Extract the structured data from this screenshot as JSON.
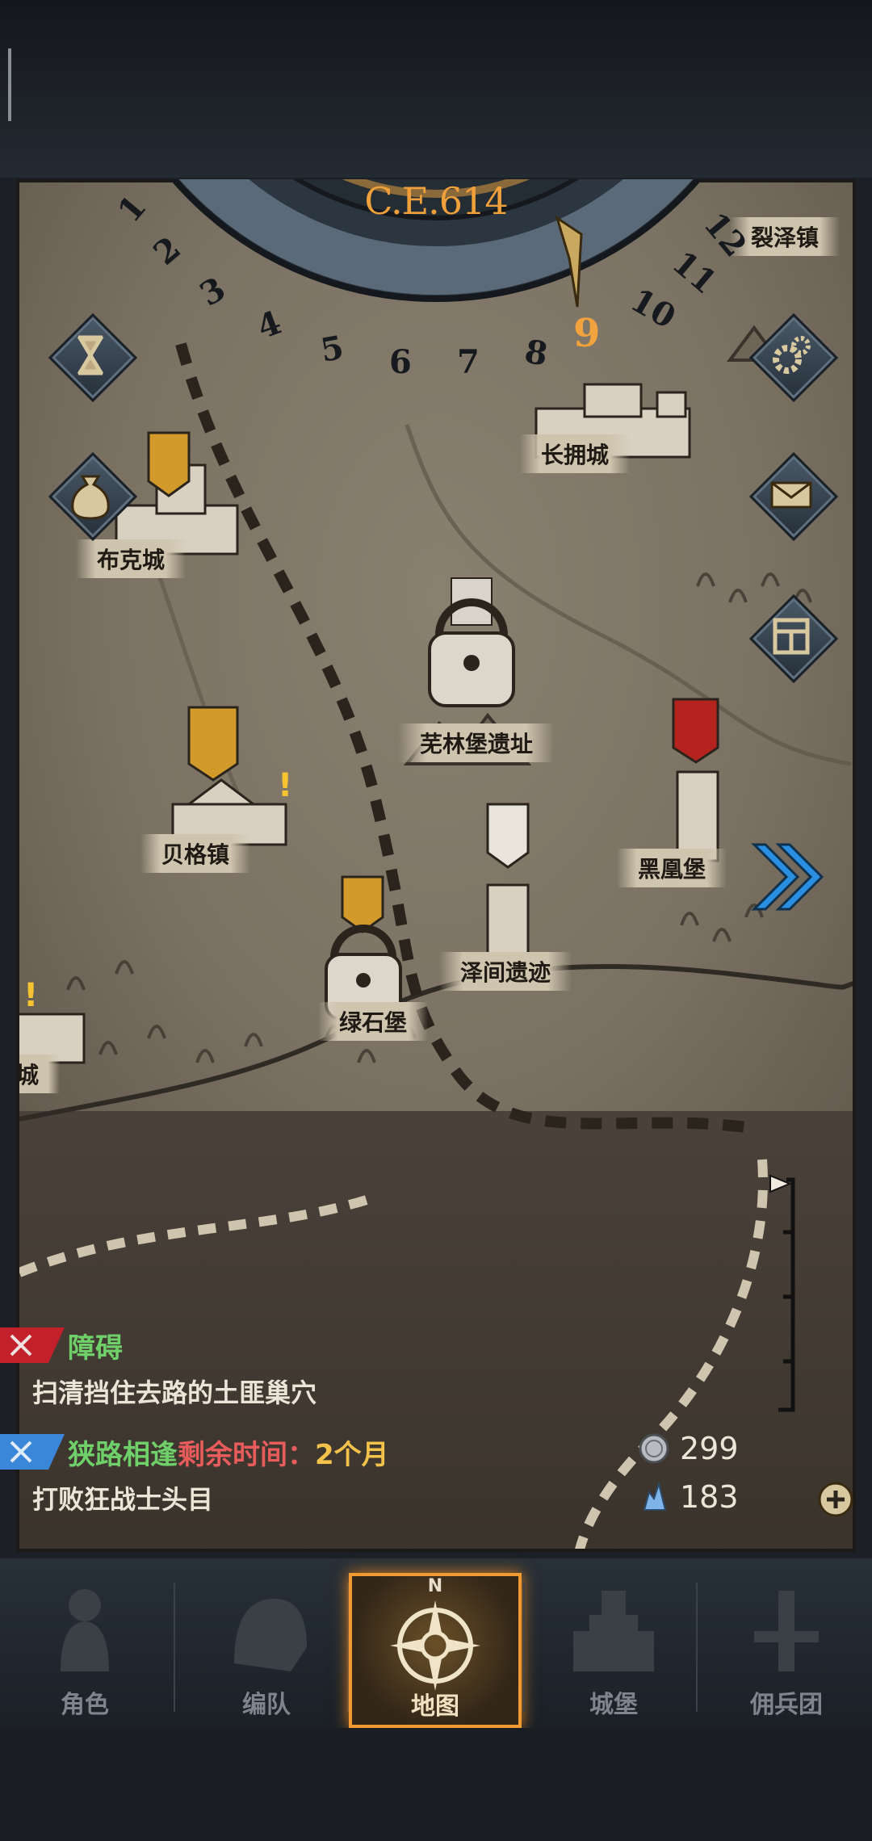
{
  "calendar": {
    "year_label": "C.E.614",
    "months": [
      "1",
      "2",
      "3",
      "4",
      "5",
      "6",
      "7",
      "8",
      "9",
      "10",
      "11",
      "12"
    ],
    "current_month": "9"
  },
  "map": {
    "locations": [
      {
        "name": "裂泽镇"
      },
      {
        "name": "长拥城"
      },
      {
        "name": "布克城"
      },
      {
        "name": "芜林堡遗址"
      },
      {
        "name": "贝格镇"
      },
      {
        "name": "黑凰堡"
      },
      {
        "name": "泽间遗迹"
      },
      {
        "name": "绿石堡"
      },
      {
        "name": "城"
      }
    ]
  },
  "side_buttons": {
    "left": [
      "hourglass-icon",
      "money-bag-icon"
    ],
    "right": [
      "gear-icon",
      "mail-icon",
      "window-icon"
    ]
  },
  "quests": [
    {
      "title": "障碍",
      "description": "扫清挡住去路的土匪巢穴",
      "color": "#6fd06a"
    },
    {
      "title": "狭路相逢",
      "time_label": "剩余时间",
      "colon": "：",
      "time_value": "2个月",
      "description": "打败狂战士头目",
      "color": "#6fd06a"
    }
  ],
  "resources": {
    "silver": "299",
    "crystal": "183"
  },
  "nav": {
    "items": [
      {
        "label": "角色"
      },
      {
        "label": "编队"
      },
      {
        "label": "地图"
      },
      {
        "label": "城堡"
      },
      {
        "label": "佣兵团"
      }
    ],
    "compass_letter": "N",
    "active": "地图"
  }
}
